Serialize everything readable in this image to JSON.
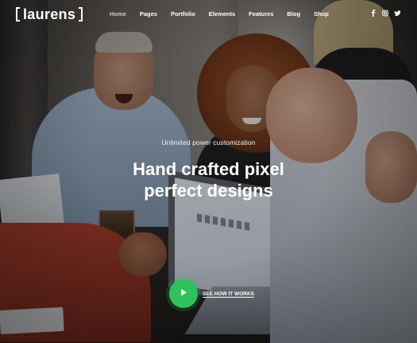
{
  "logo": {
    "text": "laurens"
  },
  "nav": {
    "items": [
      {
        "label": "Home",
        "active": true
      },
      {
        "label": "Pages"
      },
      {
        "label": "Portfolio"
      },
      {
        "label": "Elements"
      },
      {
        "label": "Features"
      },
      {
        "label": "Blog"
      },
      {
        "label": "Shop"
      }
    ]
  },
  "social": {
    "icons": [
      "facebook-icon",
      "instagram-icon",
      "twitter-icon"
    ]
  },
  "hero": {
    "subtitle": "Unlimited power customization",
    "title_line1": "Hand crafted pixel",
    "title_line2": "perfect designs",
    "cta_label": "SEE HOW IT WORKS"
  },
  "colors": {
    "accent": "#2ec25c",
    "text": "#ffffff"
  }
}
